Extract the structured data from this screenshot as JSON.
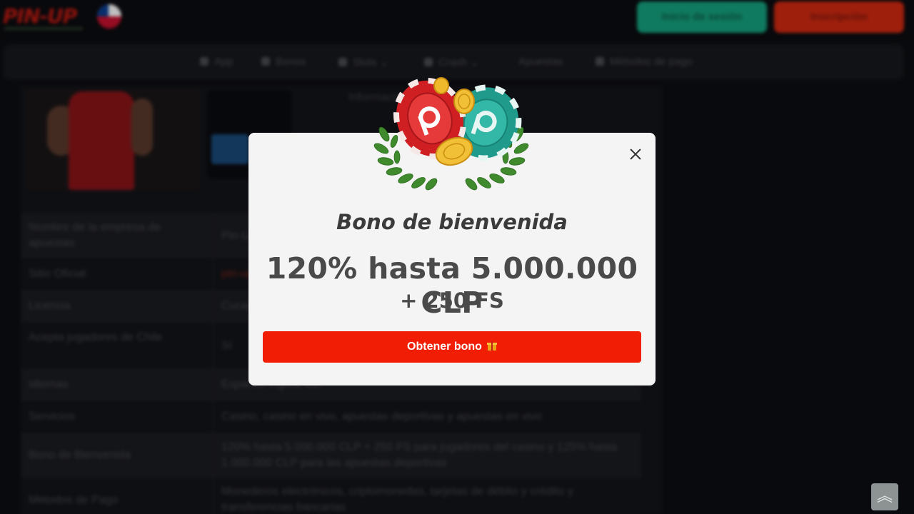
{
  "header": {
    "logo_text": "PIN-UP",
    "login_label": "Inicio de sesión",
    "register_label": "Inscripción"
  },
  "nav": {
    "items": [
      {
        "label": "App",
        "icon": "phone-icon"
      },
      {
        "label": "Bonos",
        "icon": "gift-icon"
      },
      {
        "label": "Slots",
        "icon": "slots-icon"
      },
      {
        "label": "Crash",
        "icon": "crash-icon"
      },
      {
        "label": "Apuestas",
        "icon": ""
      },
      {
        "label": "Métodos de pago",
        "icon": "card-icon"
      }
    ]
  },
  "content": {
    "promo_text": "Información",
    "table": [
      {
        "label": "Nombre de la empresa de apuestas",
        "value": "Pin-Up"
      },
      {
        "label": "Sitio Oficial",
        "value": "pin-up"
      },
      {
        "label": "Licencia",
        "value": "Curaçao"
      },
      {
        "label": "Acepta jugadores de Chile",
        "value": "Sí"
      },
      {
        "label": "Idiomas",
        "value": "Español, inglés, etc."
      },
      {
        "label": "Servicios",
        "value": "Casino, casino en vivo, apuestas deportivas y apuestas en vivo"
      },
      {
        "label": "Bono de Bienvenida",
        "value": "120% hasta 5.000.000 CLP + 250 FS para jugadores del casino y 125% hasta 1.000.000 CLP para las apuestas deportivas"
      },
      {
        "label": "Métodos de Pago",
        "value": "Monederos electrónicos, criptomonedas, tarjetas de débito y crédito y transferencias bancarias"
      }
    ]
  },
  "modal": {
    "title": "Bono de bienvenida",
    "amount": "120% hasta 5.000.000 CLP",
    "free_spins": "+ 250 FS",
    "cta_label": "Obtener bono",
    "close_icon": "close-icon",
    "badge_icon": "casino-chips-laurel-icon"
  },
  "colors": {
    "cta": "#f11d04",
    "login": "#14a37f",
    "register": "#d42a12",
    "modal_bg": "#f4f4f4"
  },
  "scroll_top_icon": "double-chevron-up-icon"
}
